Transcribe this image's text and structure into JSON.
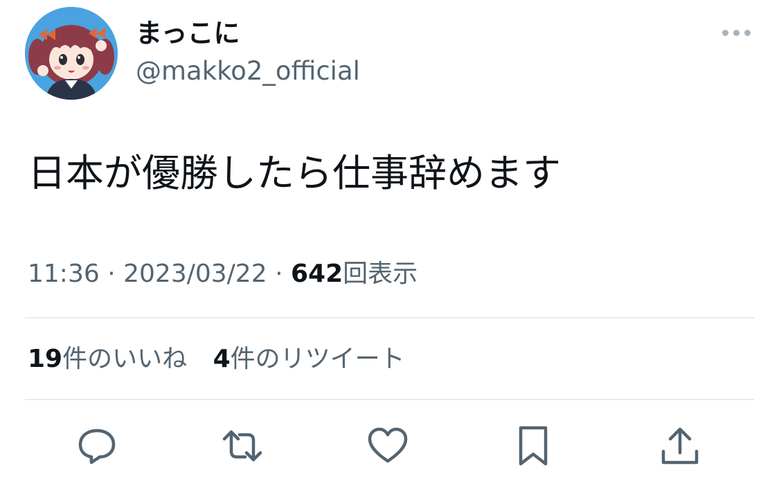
{
  "author": {
    "display_name": "まっこに",
    "handle": "@makko2_official"
  },
  "tweet": {
    "text": "日本が優勝したら仕事辞めます",
    "time": "11:36",
    "separator": "·",
    "date": "2023/03/22",
    "views_count": "642",
    "views_label": "回表示"
  },
  "stats": {
    "likes_count": "19",
    "likes_label": "件のいいね",
    "retweets_count": "4",
    "retweets_label": "件のリツイート"
  },
  "icons": {
    "more": "more-horizontal-icon",
    "reply": "reply-icon",
    "retweet": "retweet-icon",
    "like": "heart-icon",
    "bookmark": "bookmark-icon",
    "share": "share-icon"
  },
  "colors": {
    "text_primary": "#0f1419",
    "text_secondary": "#536471",
    "icon": "#536471",
    "divider": "#e6ecf0",
    "avatar_bg": "#4aa3e0"
  }
}
